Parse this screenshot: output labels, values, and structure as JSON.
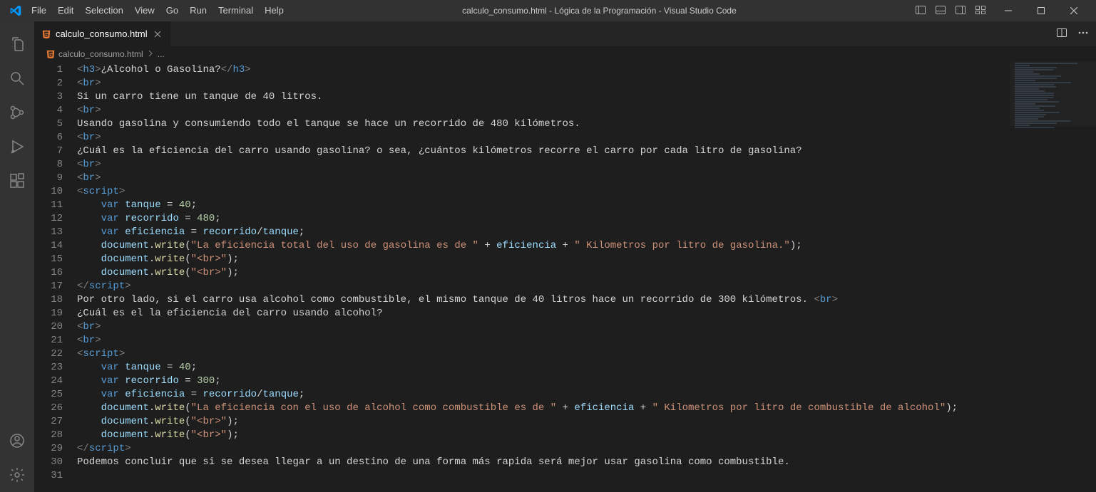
{
  "window": {
    "title": "calculo_consumo.html - Lógica de la Programación - Visual Studio Code"
  },
  "menu": {
    "items": [
      "File",
      "Edit",
      "Selection",
      "View",
      "Go",
      "Run",
      "Terminal",
      "Help"
    ]
  },
  "tab": {
    "filename": "calculo_consumo.html"
  },
  "breadcrumb": {
    "file": "calculo_consumo.html",
    "rest": "..."
  },
  "code": {
    "lines": [
      {
        "n": 1,
        "tokens": [
          {
            "t": "tag",
            "v": "<"
          },
          {
            "t": "tagname",
            "v": "h3"
          },
          {
            "t": "tag",
            "v": ">"
          },
          {
            "t": "text",
            "v": "¿Alcohol o Gasolina?"
          },
          {
            "t": "tag",
            "v": "</"
          },
          {
            "t": "tagname",
            "v": "h3"
          },
          {
            "t": "tag",
            "v": ">"
          }
        ]
      },
      {
        "n": 2,
        "tokens": [
          {
            "t": "tag",
            "v": "<"
          },
          {
            "t": "tagname",
            "v": "br"
          },
          {
            "t": "tag",
            "v": ">"
          }
        ]
      },
      {
        "n": 3,
        "tokens": [
          {
            "t": "text",
            "v": "Si un carro tiene un tanque de 40 litros."
          }
        ]
      },
      {
        "n": 4,
        "tokens": [
          {
            "t": "tag",
            "v": "<"
          },
          {
            "t": "tagname",
            "v": "br"
          },
          {
            "t": "tag",
            "v": ">"
          }
        ]
      },
      {
        "n": 5,
        "tokens": [
          {
            "t": "text",
            "v": "Usando gasolina y consumiendo todo el tanque se hace un recorrido de 480 kilómetros."
          }
        ]
      },
      {
        "n": 6,
        "tokens": [
          {
            "t": "tag",
            "v": "<"
          },
          {
            "t": "tagname",
            "v": "br"
          },
          {
            "t": "tag",
            "v": ">"
          }
        ]
      },
      {
        "n": 7,
        "tokens": [
          {
            "t": "text",
            "v": "¿Cuál es la eficiencia del carro usando gasolina? o sea, ¿cuántos kilómetros recorre el carro por cada litro de gasolina?"
          }
        ]
      },
      {
        "n": 8,
        "tokens": [
          {
            "t": "tag",
            "v": "<"
          },
          {
            "t": "tagname",
            "v": "br"
          },
          {
            "t": "tag",
            "v": ">"
          }
        ]
      },
      {
        "n": 9,
        "tokens": [
          {
            "t": "tag",
            "v": "<"
          },
          {
            "t": "tagname",
            "v": "br"
          },
          {
            "t": "tag",
            "v": ">"
          }
        ]
      },
      {
        "n": 10,
        "tokens": [
          {
            "t": "tag",
            "v": "<"
          },
          {
            "t": "tagname",
            "v": "script"
          },
          {
            "t": "tag",
            "v": ">"
          }
        ]
      },
      {
        "n": 11,
        "tokens": [
          {
            "t": "text",
            "v": "    "
          },
          {
            "t": "kw",
            "v": "var"
          },
          {
            "t": "text",
            "v": " "
          },
          {
            "t": "var",
            "v": "tanque"
          },
          {
            "t": "op",
            "v": " = "
          },
          {
            "t": "num",
            "v": "40"
          },
          {
            "t": "op",
            "v": ";"
          }
        ]
      },
      {
        "n": 12,
        "tokens": [
          {
            "t": "text",
            "v": "    "
          },
          {
            "t": "kw",
            "v": "var"
          },
          {
            "t": "text",
            "v": " "
          },
          {
            "t": "var",
            "v": "recorrido"
          },
          {
            "t": "op",
            "v": " = "
          },
          {
            "t": "num",
            "v": "480"
          },
          {
            "t": "op",
            "v": ";"
          }
        ]
      },
      {
        "n": 13,
        "tokens": [
          {
            "t": "text",
            "v": "    "
          },
          {
            "t": "kw",
            "v": "var"
          },
          {
            "t": "text",
            "v": " "
          },
          {
            "t": "var",
            "v": "eficiencia"
          },
          {
            "t": "op",
            "v": " = "
          },
          {
            "t": "var",
            "v": "recorrido"
          },
          {
            "t": "op",
            "v": "/"
          },
          {
            "t": "var",
            "v": "tanque"
          },
          {
            "t": "op",
            "v": ";"
          }
        ]
      },
      {
        "n": 14,
        "tokens": [
          {
            "t": "text",
            "v": "    "
          },
          {
            "t": "obj",
            "v": "document"
          },
          {
            "t": "op",
            "v": "."
          },
          {
            "t": "fn",
            "v": "write"
          },
          {
            "t": "op",
            "v": "("
          },
          {
            "t": "str",
            "v": "\"La eficiencia total del uso de gasolina es de \""
          },
          {
            "t": "op",
            "v": " + "
          },
          {
            "t": "var",
            "v": "eficiencia"
          },
          {
            "t": "op",
            "v": " + "
          },
          {
            "t": "str",
            "v": "\" Kilometros por litro de gasolina.\""
          },
          {
            "t": "op",
            "v": ");"
          }
        ]
      },
      {
        "n": 15,
        "tokens": [
          {
            "t": "text",
            "v": "    "
          },
          {
            "t": "obj",
            "v": "document"
          },
          {
            "t": "op",
            "v": "."
          },
          {
            "t": "fn",
            "v": "write"
          },
          {
            "t": "op",
            "v": "("
          },
          {
            "t": "str",
            "v": "\"<br>\""
          },
          {
            "t": "op",
            "v": ");"
          }
        ]
      },
      {
        "n": 16,
        "tokens": [
          {
            "t": "text",
            "v": "    "
          },
          {
            "t": "obj",
            "v": "document"
          },
          {
            "t": "op",
            "v": "."
          },
          {
            "t": "fn",
            "v": "write"
          },
          {
            "t": "op",
            "v": "("
          },
          {
            "t": "str",
            "v": "\"<br>\""
          },
          {
            "t": "op",
            "v": ");"
          }
        ]
      },
      {
        "n": 17,
        "tokens": [
          {
            "t": "tag",
            "v": "</"
          },
          {
            "t": "tagname",
            "v": "script"
          },
          {
            "t": "tag",
            "v": ">"
          }
        ]
      },
      {
        "n": 18,
        "tokens": [
          {
            "t": "text",
            "v": "Por otro lado, si el carro usa alcohol como combustible, el mismo tanque de 40 litros hace un recorrido de 300 kilómetros. "
          },
          {
            "t": "tag",
            "v": "<"
          },
          {
            "t": "tagname",
            "v": "br"
          },
          {
            "t": "tag",
            "v": ">"
          }
        ]
      },
      {
        "n": 19,
        "tokens": [
          {
            "t": "text",
            "v": "¿Cuál es el la eficiencia del carro usando alcohol?"
          }
        ]
      },
      {
        "n": 20,
        "tokens": [
          {
            "t": "tag",
            "v": "<"
          },
          {
            "t": "tagname",
            "v": "br"
          },
          {
            "t": "tag",
            "v": ">"
          }
        ]
      },
      {
        "n": 21,
        "tokens": [
          {
            "t": "tag",
            "v": "<"
          },
          {
            "t": "tagname",
            "v": "br"
          },
          {
            "t": "tag",
            "v": ">"
          }
        ]
      },
      {
        "n": 22,
        "tokens": [
          {
            "t": "tag",
            "v": "<"
          },
          {
            "t": "tagname",
            "v": "script"
          },
          {
            "t": "tag",
            "v": ">"
          }
        ]
      },
      {
        "n": 23,
        "tokens": [
          {
            "t": "text",
            "v": "    "
          },
          {
            "t": "kw",
            "v": "var"
          },
          {
            "t": "text",
            "v": " "
          },
          {
            "t": "var",
            "v": "tanque"
          },
          {
            "t": "op",
            "v": " = "
          },
          {
            "t": "num",
            "v": "40"
          },
          {
            "t": "op",
            "v": ";"
          }
        ]
      },
      {
        "n": 24,
        "tokens": [
          {
            "t": "text",
            "v": "    "
          },
          {
            "t": "kw",
            "v": "var"
          },
          {
            "t": "text",
            "v": " "
          },
          {
            "t": "var",
            "v": "recorrido"
          },
          {
            "t": "op",
            "v": " = "
          },
          {
            "t": "num",
            "v": "300"
          },
          {
            "t": "op",
            "v": ";"
          }
        ]
      },
      {
        "n": 25,
        "tokens": [
          {
            "t": "text",
            "v": "    "
          },
          {
            "t": "kw",
            "v": "var"
          },
          {
            "t": "text",
            "v": " "
          },
          {
            "t": "var",
            "v": "eficiencia"
          },
          {
            "t": "op",
            "v": " = "
          },
          {
            "t": "var",
            "v": "recorrido"
          },
          {
            "t": "op",
            "v": "/"
          },
          {
            "t": "var",
            "v": "tanque"
          },
          {
            "t": "op",
            "v": ";"
          }
        ]
      },
      {
        "n": 26,
        "tokens": [
          {
            "t": "text",
            "v": "    "
          },
          {
            "t": "obj",
            "v": "document"
          },
          {
            "t": "op",
            "v": "."
          },
          {
            "t": "fn",
            "v": "write"
          },
          {
            "t": "op",
            "v": "("
          },
          {
            "t": "str",
            "v": "\"La eficiencia con el uso de alcohol como combustible es de \""
          },
          {
            "t": "op",
            "v": " + "
          },
          {
            "t": "var",
            "v": "eficiencia"
          },
          {
            "t": "op",
            "v": " + "
          },
          {
            "t": "str",
            "v": "\" Kilometros por litro de combustible de alcohol\""
          },
          {
            "t": "op",
            "v": ");"
          }
        ]
      },
      {
        "n": 27,
        "tokens": [
          {
            "t": "text",
            "v": "    "
          },
          {
            "t": "obj",
            "v": "document"
          },
          {
            "t": "op",
            "v": "."
          },
          {
            "t": "fn",
            "v": "write"
          },
          {
            "t": "op",
            "v": "("
          },
          {
            "t": "str",
            "v": "\"<br>\""
          },
          {
            "t": "op",
            "v": ");"
          }
        ]
      },
      {
        "n": 28,
        "tokens": [
          {
            "t": "text",
            "v": "    "
          },
          {
            "t": "obj",
            "v": "document"
          },
          {
            "t": "op",
            "v": "."
          },
          {
            "t": "fn",
            "v": "write"
          },
          {
            "t": "op",
            "v": "("
          },
          {
            "t": "str",
            "v": "\"<br>\""
          },
          {
            "t": "op",
            "v": ");"
          }
        ]
      },
      {
        "n": 29,
        "tokens": [
          {
            "t": "tag",
            "v": "</"
          },
          {
            "t": "tagname",
            "v": "script"
          },
          {
            "t": "tag",
            "v": ">"
          }
        ]
      },
      {
        "n": 30,
        "tokens": [
          {
            "t": "text",
            "v": "Podemos concluir que si se desea llegar a un destino de una forma más rapida será mejor usar gasolina como combustible."
          }
        ]
      },
      {
        "n": 31,
        "tokens": []
      }
    ]
  }
}
